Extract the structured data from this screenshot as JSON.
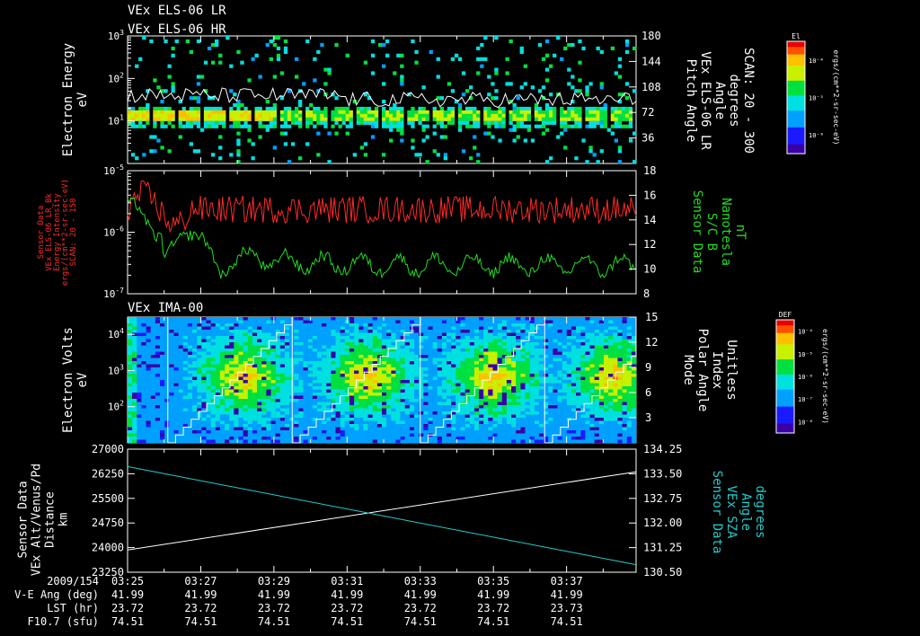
{
  "titles": {
    "panel1_line1": "VEx ELS-06 LR",
    "panel1_line2": "VEx ELS-06 HR",
    "panel3": "VEx IMA-00"
  },
  "colorbars": [
    {
      "label": "El",
      "ticks": [
        "10⁻⁴",
        "10⁻⁵",
        "10⁻⁶"
      ],
      "unit": "ergs/(cm**2-sr-sec-eV)"
    },
    {
      "label": "DEF",
      "ticks": [
        "10⁻⁴",
        "10⁻⁵",
        "10⁻⁶",
        "10⁻⁷",
        "10⁻⁸"
      ],
      "unit": "ergs/(cm**2-sr-sec-eV)"
    }
  ],
  "colors": {
    "white": "#ffffff",
    "red": "#ff2a2a",
    "green": "#22dd22",
    "cyan": "#22cccc",
    "axes": "#ffffff",
    "background": "#000000"
  },
  "time_axis": {
    "ticks": [
      "03:25",
      "03:27",
      "03:29",
      "03:31",
      "03:33",
      "03:35",
      "03:37"
    ],
    "range_minutes": [
      0,
      13.9
    ]
  },
  "footer": {
    "row_labels": [
      "2009/154",
      "V-E Ang (deg)",
      "LST (hr)",
      "F10.7 (sfu)"
    ],
    "vea": [
      "41.99",
      "41.99",
      "41.99",
      "41.99",
      "41.99",
      "41.99",
      "41.99"
    ],
    "lst": [
      "23.72",
      "23.72",
      "23.72",
      "23.72",
      "23.72",
      "23.72",
      "23.73"
    ],
    "f107": [
      "74.51",
      "74.51",
      "74.51",
      "74.51",
      "74.51",
      "74.51",
      "74.51"
    ]
  },
  "chart_data": [
    {
      "type": "heatmap",
      "left_label_lines": [
        "Electron Energy",
        "eV"
      ],
      "left_ticks": [
        {
          "base": "10",
          "exp": "3",
          "value": 1000
        },
        {
          "base": "10",
          "exp": "2",
          "value": 100
        },
        {
          "base": "10",
          "exp": "1",
          "value": 10
        }
      ],
      "ylim": [
        1,
        1000
      ],
      "yscale": "log",
      "right_label_lines": [
        "Pitch Angle",
        "VEx ELS-06 LR",
        "Angle",
        "degrees",
        "SCAN: 20 - 300"
      ],
      "right_ticks": [
        "180",
        "144",
        "108",
        "72",
        "36"
      ],
      "right_lim": [
        0,
        180
      ],
      "notes": "Electron spectrogram; intense band near 10-20 eV with scattered counts; white trace of pitch angle around 90-108 deg."
    },
    {
      "type": "line",
      "left_label_lines": [
        "Sensor Data",
        "VEx ELS-06 LR_Bk",
        "Energy Intensity",
        "ergs/(cm**2-sr-sec-eV)",
        "SCAN: 20 - 150"
      ],
      "left_ticks": [
        {
          "base": "10",
          "exp": "-5",
          "value": 1e-05
        },
        {
          "base": "10",
          "exp": "-6",
          "value": 1e-06
        },
        {
          "base": "10",
          "exp": "-7",
          "value": 1e-07
        }
      ],
      "ylim": [
        1e-07,
        1e-05
      ],
      "yscale": "log",
      "right_label_lines": [
        "Sensor Data",
        "S/C B",
        "Nanotesla",
        "nT"
      ],
      "right_ticks": [
        "18",
        "16",
        "14",
        "12",
        "10",
        "8"
      ],
      "right_lim": [
        8,
        18
      ],
      "series": [
        {
          "name": "red",
          "axis": "left",
          "color": "red"
        },
        {
          "name": "green",
          "axis": "right",
          "color": "green"
        }
      ],
      "notes": "Red: energy intensity ~2e-6 to 7e-6; Green: magnetic field ~10-16 nT decaying to ~10 nT."
    },
    {
      "type": "heatmap",
      "left_label_lines": [
        "Electron Volts",
        "eV"
      ],
      "left_ticks": [
        {
          "base": "10",
          "exp": "4",
          "value": 10000
        },
        {
          "base": "10",
          "exp": "3",
          "value": 1000
        },
        {
          "base": "10",
          "exp": "2",
          "value": 100
        }
      ],
      "ylim": [
        10,
        30000
      ],
      "yscale": "log",
      "right_label_lines": [
        "Mode",
        "Polar Angle",
        "Index",
        "Unitless"
      ],
      "right_ticks": [
        "15",
        "12",
        "9",
        "6",
        "3"
      ],
      "right_lim": [
        0,
        15
      ],
      "scan_boundaries_minutes": [
        1.1,
        4.5,
        8.0,
        11.4
      ],
      "notes": "Ion spectrogram with peak flux near 500-1000 eV; white sawtooth of polar angle index 0-15 over each scan."
    },
    {
      "type": "line",
      "left_label_lines": [
        "Sensor Data",
        "VEx Alt/Venus/Pd",
        "Distance",
        "km"
      ],
      "left_ticks": [
        "27000",
        "26250",
        "25500",
        "24750",
        "24000",
        "23250"
      ],
      "ylim": [
        23250,
        27000
      ],
      "right_label_lines": [
        "Sensor Data",
        "VEx SZA",
        "Angle",
        "degrees"
      ],
      "right_ticks": [
        "134.25",
        "133.50",
        "132.75",
        "132.00",
        "131.25",
        "130.50"
      ],
      "right_lim": [
        130.5,
        134.25
      ],
      "series": [
        {
          "name": "white",
          "axis": "left",
          "x": [
            0,
            13.9
          ],
          "y": [
            23925,
            26310
          ]
        },
        {
          "name": "cyan",
          "axis": "right",
          "x": [
            0,
            13.9
          ],
          "y": [
            133.72,
            130.73
          ]
        }
      ]
    }
  ]
}
